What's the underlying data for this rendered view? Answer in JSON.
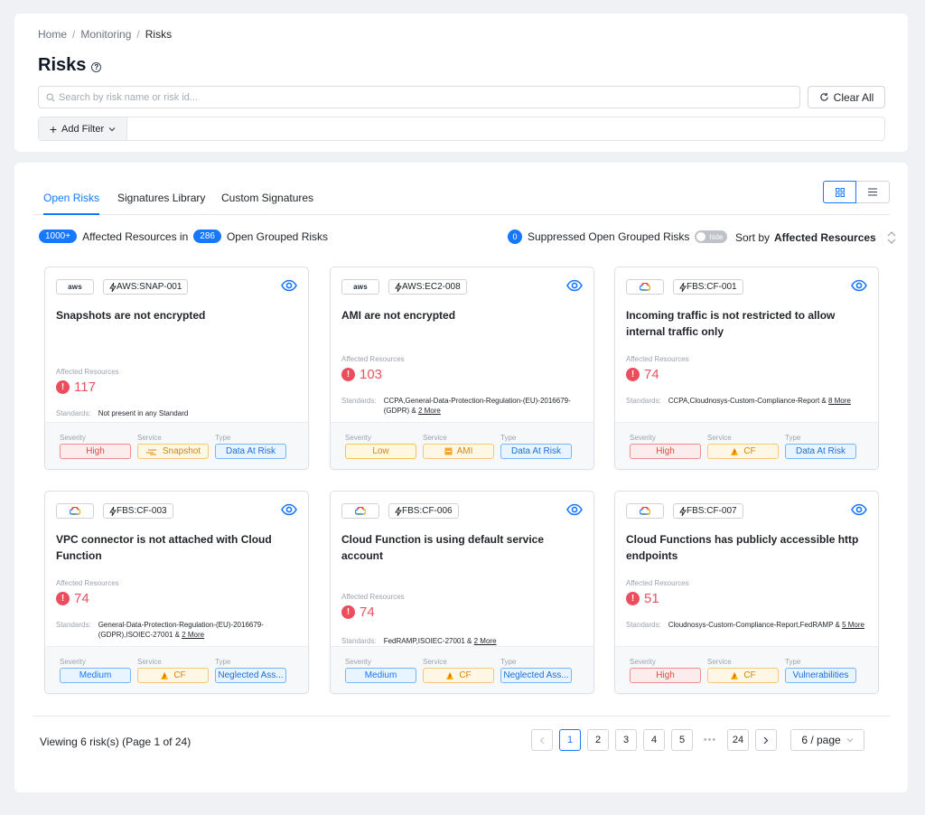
{
  "breadcrumb": [
    "Home",
    "Monitoring",
    "Risks"
  ],
  "page_title": "Risks",
  "search": {
    "placeholder": "Search by risk name or risk id..."
  },
  "clear_all_label": "Clear All",
  "add_filter_label": "Add Filter",
  "tabs": [
    {
      "label": "Open Risks",
      "active": true
    },
    {
      "label": "Signatures Library",
      "active": false
    },
    {
      "label": "Custom Signatures",
      "active": false
    }
  ],
  "summary": {
    "affected_count": "1000+",
    "affected_text": "Affected Resources in",
    "grouped_count": "286",
    "grouped_text": "Open Grouped Risks",
    "suppressed_count": "0",
    "suppressed_text": "Suppressed Open Grouped Risks",
    "toggle_label": "hide",
    "sort_label": "Sort by",
    "sort_value": "Affected Resources"
  },
  "card_labels": {
    "affected_resources": "Affected Resources",
    "standards": "Standards:",
    "severity": "Severity",
    "service": "Service",
    "type": "Type"
  },
  "cards": [
    {
      "cloud": "aws",
      "signature": "AWS:SNAP-001",
      "title": "Snapshots are not encrypted",
      "affected": "117",
      "standards": "Not present in any Standard",
      "more": "",
      "severity": "High",
      "service": "Snapshot",
      "type": "Data At Risk"
    },
    {
      "cloud": "aws",
      "signature": "AWS:EC2-008",
      "title": "AMI are not encrypted",
      "affected": "103",
      "standards": "CCPA,General-Data-Protection-Regulation-(EU)-2016679-(GDPR) &",
      "more": "2 More",
      "severity": "Low",
      "service": "AMI",
      "type": "Data At Risk"
    },
    {
      "cloud": "gcp",
      "signature": "FBS:CF-001",
      "title": "Incoming traffic is not restricted to allow internal traffic only",
      "affected": "74",
      "standards": "CCPA,Cloudnosys-Custom-Compliance-Report &",
      "more": "8 More",
      "severity": "High",
      "service": "CF",
      "type": "Data At Risk"
    },
    {
      "cloud": "gcp",
      "signature": "FBS:CF-003",
      "title": "VPC connector is not attached with Cloud Function",
      "affected": "74",
      "standards": "General-Data-Protection-Regulation-(EU)-2016679-(GDPR),ISOIEC-27001 &",
      "more": "2 More",
      "severity": "Medium",
      "service": "CF",
      "type": "Neglected Ass..."
    },
    {
      "cloud": "gcp",
      "signature": "FBS:CF-006",
      "title": "Cloud Function is using default service account",
      "affected": "74",
      "standards": "FedRAMP,ISOIEC-27001 &",
      "more": "2 More",
      "severity": "Medium",
      "service": "CF",
      "type": "Neglected Ass..."
    },
    {
      "cloud": "gcp",
      "signature": "FBS:CF-007",
      "title": "Cloud Functions has publicly accessible http endpoints",
      "affected": "51",
      "standards": "Cloudnosys-Custom-Compliance-Report,FedRAMP &",
      "more": "5 More",
      "severity": "High",
      "service": "CF",
      "type": "Vulnerabilities"
    }
  ],
  "pagination": {
    "viewing": "Viewing 6 risk(s) (Page 1 of 24)",
    "pages": [
      "1",
      "2",
      "3",
      "4",
      "5",
      "24"
    ],
    "current": "1",
    "per_page": "6 / page"
  },
  "colors": {
    "accent": "#1677ff",
    "danger": "#ec4c5c"
  }
}
